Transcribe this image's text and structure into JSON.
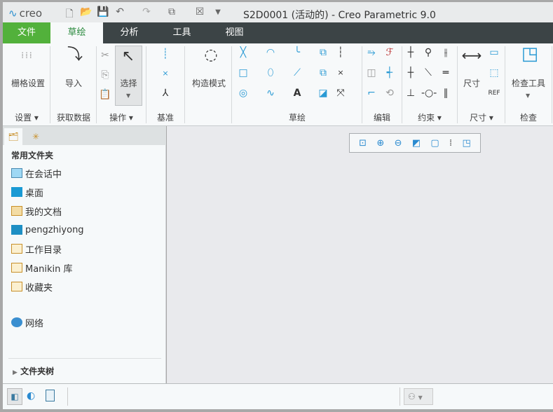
{
  "titlebar": {
    "logo": "creo",
    "title": "S2D0001 (活动的) - Creo Parametric 9.0"
  },
  "tabs": [
    "文件",
    "草绘",
    "分析",
    "工具",
    "视图"
  ],
  "ribbon": {
    "grid_settings": "栅格设置",
    "import": "导入",
    "select": "选择",
    "construction_mode": "构造模式",
    "dimension": "尺寸",
    "inspect_tools": "检查工具",
    "groups": [
      "设置",
      "获取数据",
      "操作",
      "基准",
      "草绘",
      "编辑",
      "约束",
      "尺寸",
      "检查"
    ]
  },
  "panel": {
    "header": "常用文件夹",
    "items": [
      "在会话中",
      "桌面",
      "我的文档",
      "pengzhiyong",
      "工作目录",
      "Manikin 库",
      "收藏夹"
    ],
    "network": "网络",
    "folder_tree": "文件夹树"
  },
  "colors": {
    "accent": "#2a9ad4",
    "file_tab": "#52b13b",
    "tabbar": "#3c4446"
  }
}
